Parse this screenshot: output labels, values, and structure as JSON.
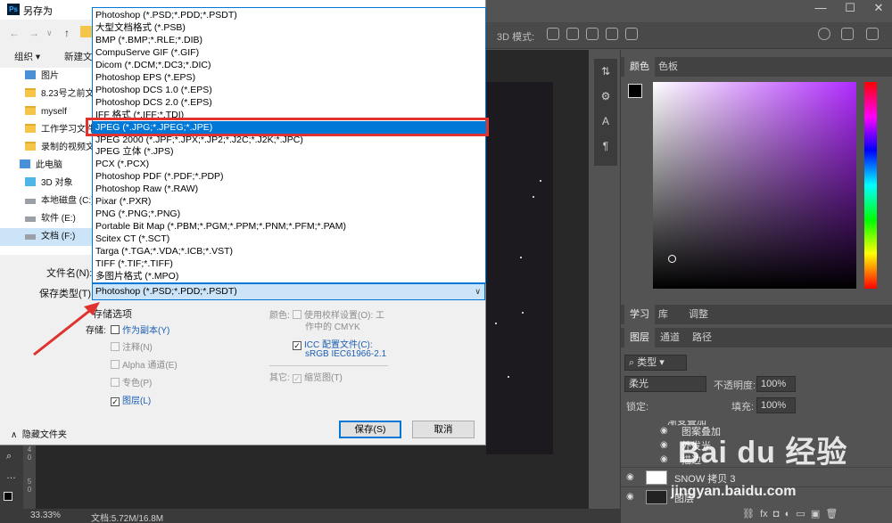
{
  "dialog": {
    "title": "另存为",
    "organize": "组织 ▾",
    "new_folder": "新建文",
    "tree": [
      {
        "label": "图片",
        "icon": "pictures-icon"
      },
      {
        "label": "8.23号之前文",
        "icon": "folder-icon"
      },
      {
        "label": "myself",
        "icon": "folder-icon"
      },
      {
        "label": "工作学习文件",
        "icon": "folder-icon"
      },
      {
        "label": "录制的视频文",
        "icon": "folder-icon"
      },
      {
        "label": "此电脑",
        "icon": "computer-icon"
      },
      {
        "label": "3D 对象",
        "icon": "3d-objects-icon"
      },
      {
        "label": "本地磁盘 (C:)",
        "icon": "drive-icon"
      },
      {
        "label": "软件 (E:)",
        "icon": "drive-icon"
      },
      {
        "label": "文档 (F:)",
        "icon": "drive-icon",
        "selected": true
      }
    ],
    "filename_label": "文件名(N):",
    "savetype_label": "保存类型(T):",
    "savetype_value": "Photoshop (*.PSD;*.PDD;*.PSDT)",
    "format_options": [
      "Photoshop (*.PSD;*.PDD;*.PSDT)",
      "大型文档格式 (*.PSB)",
      "BMP (*.BMP;*.RLE;*.DIB)",
      "CompuServe GIF (*.GIF)",
      "Dicom (*.DCM;*.DC3;*.DIC)",
      "Photoshop EPS (*.EPS)",
      "Photoshop DCS 1.0 (*.EPS)",
      "Photoshop DCS 2.0 (*.EPS)",
      "IFF 格式 (*.IFF;*.TDI)",
      "JPEG (*.JPG;*.JPEG;*.JPE)",
      "JPEG 2000 (*.JPF;*.JPX;*.JP2;*.J2C;*.J2K;*.JPC)",
      "JPEG 立体 (*.JPS)",
      "PCX (*.PCX)",
      "Photoshop PDF (*.PDF;*.PDP)",
      "Photoshop Raw (*.RAW)",
      "Pixar (*.PXR)",
      "PNG (*.PNG;*.PNG)",
      "Portable Bit Map (*.PBM;*.PGM;*.PPM;*.PNM;*.PFM;*.PAM)",
      "Scitex CT (*.SCT)",
      "Targa (*.TGA;*.VDA;*.ICB;*.VST)",
      "TIFF (*.TIF;*.TIFF)",
      "多图片格式 (*.MPO)"
    ],
    "selected_format_index": 9,
    "save_options": {
      "title": "存储选项",
      "storage_label": "存储:",
      "as_copy": "作为副本(Y)",
      "notes": "注释(N)",
      "alpha": "Alpha 通道(E)",
      "spot": "专色(P)",
      "layers": "图层(L)",
      "color_label": "颜色:",
      "use_proof_1": "使用校样设置(O):  工",
      "use_proof_2": "作中的 CMYK",
      "icc_1": "ICC 配置文件(C):",
      "icc_2": "sRGB IEC61966-2.1",
      "other_label": "其它:",
      "thumbnail": "缩览图(T)"
    },
    "save_button": "保存(S)",
    "cancel_button": "取消",
    "hide_folders": "隐藏文件夹"
  },
  "photoshop": {
    "mode_label": "3D 模式:",
    "color_tab": "颜色",
    "swatches_tab": "色板",
    "learn_tab": "学习",
    "library_tab": "库",
    "adjust_tab": "调整",
    "layers_tab": "图层",
    "channels_tab": "通道",
    "paths_tab": "路径",
    "filter_kind": "类型",
    "blend_mode": "柔光",
    "opacity_label": "不透明度:",
    "opacity_value": "100%",
    "lock_label": "锁定:",
    "fill_label": "填充:",
    "fill_value": "100%",
    "effects": [
      "图案叠加",
      "外发光",
      "描边"
    ],
    "effect_top_partial": "渐变叠加",
    "layer1": "SNOW 拷贝 3",
    "layer2": "图层",
    "zoom": "33.33%",
    "doc_info": "文档:5.72M/16.8M",
    "ruler_labels": [
      "4",
      "0",
      "5",
      "0"
    ]
  },
  "watermark": {
    "brand": "Bai du 经验",
    "url": "jingyan.baidu.com"
  },
  "colors": {
    "accent": "#0078d7",
    "highlight_box": "#e0322e",
    "ps_panel": "#535353"
  }
}
